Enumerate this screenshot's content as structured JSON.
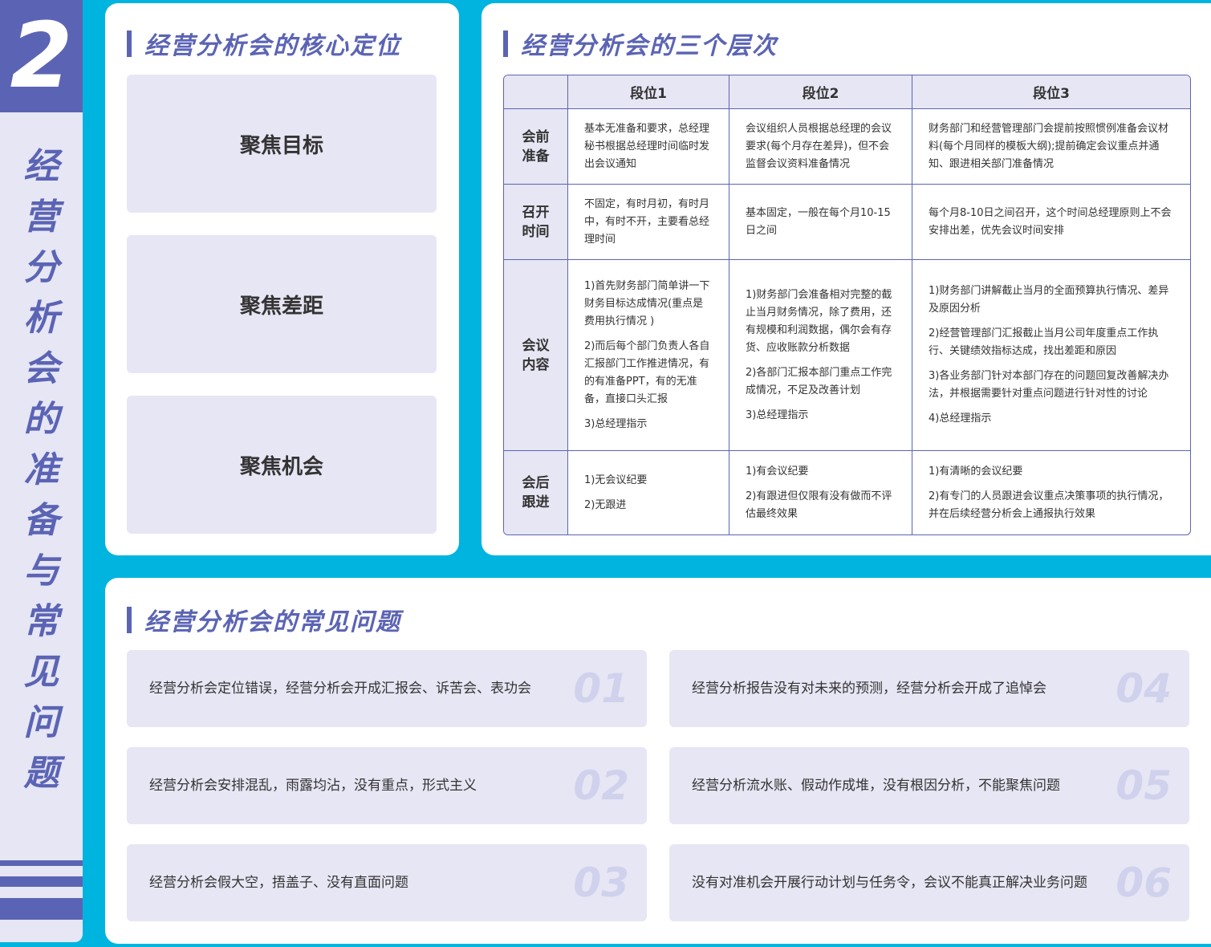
{
  "section": {
    "number": "2",
    "vertical_title_chars": [
      "经",
      "营",
      "分",
      "析",
      "会",
      "的",
      "准",
      "备",
      "与",
      "常",
      "见",
      "问",
      "题"
    ]
  },
  "core": {
    "title": "经营分析会的核心定位",
    "items": [
      "聚焦目标",
      "聚焦差距",
      "聚焦机会"
    ]
  },
  "levels": {
    "title": "经营分析会的三个层次",
    "headers": [
      "",
      "段位1",
      "段位2",
      "段位3"
    ],
    "rows": [
      {
        "label": [
          "会前",
          "准备"
        ],
        "cells": [
          [
            "基本无准备和要求，总经理秘书根据总经理时间临时发出会议通知"
          ],
          [
            "会议组织人员根据总经理的会议要求(每个月存在差异)，但不会监督会议资料准备情况"
          ],
          [
            "财务部门和经营管理部门会提前按照惯例准备会议材料(每个月同样的模板大纲);提前确定会议重点并通知、跟进相关部门准备情况"
          ]
        ]
      },
      {
        "label": [
          "召开",
          "时间"
        ],
        "cells": [
          [
            "不固定，有时月初，有时月中，有时不开，主要看总经理时间"
          ],
          [
            "基本固定，一般在每个月10-15日之间"
          ],
          [
            "每个月8-10日之间召开，这个时间总经理原则上不会安排出差，优先会议时间安排"
          ]
        ]
      },
      {
        "label": [
          "会议",
          "内容"
        ],
        "cells": [
          [
            "1)首先财务部门简单讲一下财务目标达成情况(重点是费用执行情况 )",
            "2)而后每个部门负责人各自汇报部门工作推进情况，有的有准备PPT，有的无准备，直接口头汇报",
            "3)总经理指示"
          ],
          [
            "1)财务部门会准备相对完整的截止当月财务情况，除了费用，还有规模和利润数据，偶尔会有存货、应收账款分析数据",
            "2)各部门汇报本部门重点工作完成情况，不足及改善计划",
            "3)总经理指示"
          ],
          [
            "1)财务部门讲解截止当月的全面预算执行情况、差异及原因分析",
            "2)经营管理部门汇报截止当月公司年度重点工作执行、关键绩效指标达成，找出差距和原因",
            "3)各业务部门针对本部门存在的问题回复改善解决办法，并根据需要针对重点问题进行针对性的讨论",
            "4)总经理指示"
          ]
        ]
      },
      {
        "label": [
          "会后",
          "跟进"
        ],
        "cells": [
          [
            "1)无会议纪要",
            "2)无跟进"
          ],
          [
            "1)有会议纪要",
            "2)有跟进但仅限有没有做而不评估最终效果"
          ],
          [
            "1)有清晰的会议纪要",
            "2)有专门的人员跟进会议重点决策事项的执行情况，并在后续经营分析会上通报执行效果"
          ]
        ]
      }
    ]
  },
  "problems": {
    "title": "经营分析会的常见问题",
    "items": [
      {
        "num": "01",
        "text": "经营分析会定位错误，经营分析会开成汇报会、诉苦会、表功会"
      },
      {
        "num": "02",
        "text": "经营分析会安排混乱，雨露均沾，没有重点，形式主义"
      },
      {
        "num": "03",
        "text": "经营分析会假大空，捂盖子、没有直面问题"
      },
      {
        "num": "04",
        "text": "经营分析报告没有对未来的预测，经营分析会开成了追悼会"
      },
      {
        "num": "05",
        "text": "经营分析流水账、假动作成堆，没有根因分析，不能聚焦问题"
      },
      {
        "num": "06",
        "text": "没有对准机会开展行动计划与任务令，会议不能真正解决业务问题"
      }
    ]
  }
}
